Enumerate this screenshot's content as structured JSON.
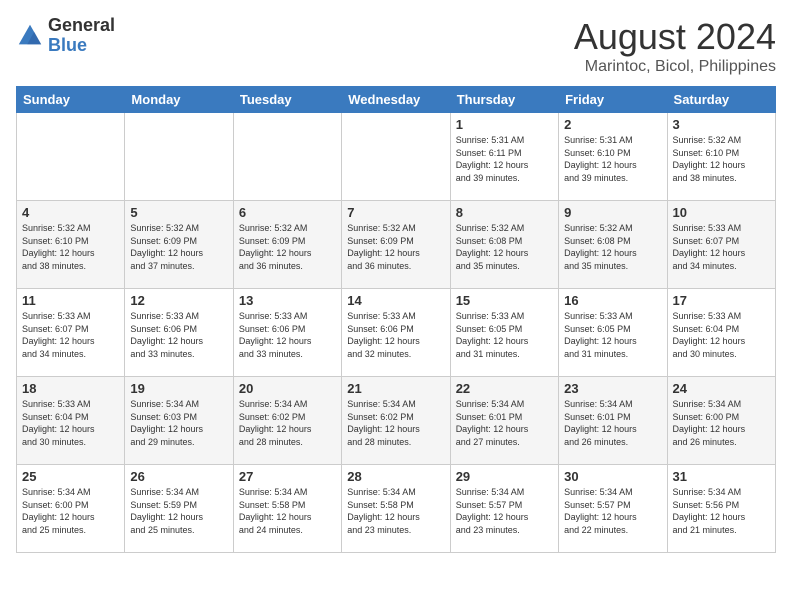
{
  "logo": {
    "general": "General",
    "blue": "Blue"
  },
  "title": {
    "month_year": "August 2024",
    "location": "Marintoc, Bicol, Philippines"
  },
  "weekdays": [
    "Sunday",
    "Monday",
    "Tuesday",
    "Wednesday",
    "Thursday",
    "Friday",
    "Saturday"
  ],
  "weeks": [
    [
      {
        "day": "",
        "info": ""
      },
      {
        "day": "",
        "info": ""
      },
      {
        "day": "",
        "info": ""
      },
      {
        "day": "",
        "info": ""
      },
      {
        "day": "1",
        "info": "Sunrise: 5:31 AM\nSunset: 6:11 PM\nDaylight: 12 hours\nand 39 minutes."
      },
      {
        "day": "2",
        "info": "Sunrise: 5:31 AM\nSunset: 6:10 PM\nDaylight: 12 hours\nand 39 minutes."
      },
      {
        "day": "3",
        "info": "Sunrise: 5:32 AM\nSunset: 6:10 PM\nDaylight: 12 hours\nand 38 minutes."
      }
    ],
    [
      {
        "day": "4",
        "info": "Sunrise: 5:32 AM\nSunset: 6:10 PM\nDaylight: 12 hours\nand 38 minutes."
      },
      {
        "day": "5",
        "info": "Sunrise: 5:32 AM\nSunset: 6:09 PM\nDaylight: 12 hours\nand 37 minutes."
      },
      {
        "day": "6",
        "info": "Sunrise: 5:32 AM\nSunset: 6:09 PM\nDaylight: 12 hours\nand 36 minutes."
      },
      {
        "day": "7",
        "info": "Sunrise: 5:32 AM\nSunset: 6:09 PM\nDaylight: 12 hours\nand 36 minutes."
      },
      {
        "day": "8",
        "info": "Sunrise: 5:32 AM\nSunset: 6:08 PM\nDaylight: 12 hours\nand 35 minutes."
      },
      {
        "day": "9",
        "info": "Sunrise: 5:32 AM\nSunset: 6:08 PM\nDaylight: 12 hours\nand 35 minutes."
      },
      {
        "day": "10",
        "info": "Sunrise: 5:33 AM\nSunset: 6:07 PM\nDaylight: 12 hours\nand 34 minutes."
      }
    ],
    [
      {
        "day": "11",
        "info": "Sunrise: 5:33 AM\nSunset: 6:07 PM\nDaylight: 12 hours\nand 34 minutes."
      },
      {
        "day": "12",
        "info": "Sunrise: 5:33 AM\nSunset: 6:06 PM\nDaylight: 12 hours\nand 33 minutes."
      },
      {
        "day": "13",
        "info": "Sunrise: 5:33 AM\nSunset: 6:06 PM\nDaylight: 12 hours\nand 33 minutes."
      },
      {
        "day": "14",
        "info": "Sunrise: 5:33 AM\nSunset: 6:06 PM\nDaylight: 12 hours\nand 32 minutes."
      },
      {
        "day": "15",
        "info": "Sunrise: 5:33 AM\nSunset: 6:05 PM\nDaylight: 12 hours\nand 31 minutes."
      },
      {
        "day": "16",
        "info": "Sunrise: 5:33 AM\nSunset: 6:05 PM\nDaylight: 12 hours\nand 31 minutes."
      },
      {
        "day": "17",
        "info": "Sunrise: 5:33 AM\nSunset: 6:04 PM\nDaylight: 12 hours\nand 30 minutes."
      }
    ],
    [
      {
        "day": "18",
        "info": "Sunrise: 5:33 AM\nSunset: 6:04 PM\nDaylight: 12 hours\nand 30 minutes."
      },
      {
        "day": "19",
        "info": "Sunrise: 5:34 AM\nSunset: 6:03 PM\nDaylight: 12 hours\nand 29 minutes."
      },
      {
        "day": "20",
        "info": "Sunrise: 5:34 AM\nSunset: 6:02 PM\nDaylight: 12 hours\nand 28 minutes."
      },
      {
        "day": "21",
        "info": "Sunrise: 5:34 AM\nSunset: 6:02 PM\nDaylight: 12 hours\nand 28 minutes."
      },
      {
        "day": "22",
        "info": "Sunrise: 5:34 AM\nSunset: 6:01 PM\nDaylight: 12 hours\nand 27 minutes."
      },
      {
        "day": "23",
        "info": "Sunrise: 5:34 AM\nSunset: 6:01 PM\nDaylight: 12 hours\nand 26 minutes."
      },
      {
        "day": "24",
        "info": "Sunrise: 5:34 AM\nSunset: 6:00 PM\nDaylight: 12 hours\nand 26 minutes."
      }
    ],
    [
      {
        "day": "25",
        "info": "Sunrise: 5:34 AM\nSunset: 6:00 PM\nDaylight: 12 hours\nand 25 minutes."
      },
      {
        "day": "26",
        "info": "Sunrise: 5:34 AM\nSunset: 5:59 PM\nDaylight: 12 hours\nand 25 minutes."
      },
      {
        "day": "27",
        "info": "Sunrise: 5:34 AM\nSunset: 5:58 PM\nDaylight: 12 hours\nand 24 minutes."
      },
      {
        "day": "28",
        "info": "Sunrise: 5:34 AM\nSunset: 5:58 PM\nDaylight: 12 hours\nand 23 minutes."
      },
      {
        "day": "29",
        "info": "Sunrise: 5:34 AM\nSunset: 5:57 PM\nDaylight: 12 hours\nand 23 minutes."
      },
      {
        "day": "30",
        "info": "Sunrise: 5:34 AM\nSunset: 5:57 PM\nDaylight: 12 hours\nand 22 minutes."
      },
      {
        "day": "31",
        "info": "Sunrise: 5:34 AM\nSunset: 5:56 PM\nDaylight: 12 hours\nand 21 minutes."
      }
    ]
  ]
}
